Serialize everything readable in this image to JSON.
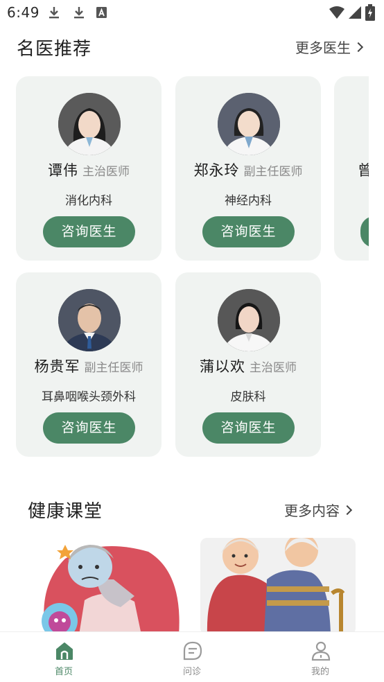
{
  "status_bar": {
    "time": "6:49"
  },
  "doctors_section": {
    "title": "名医推荐",
    "more_label": "更多医生"
  },
  "doctors": [
    {
      "name": "谭伟",
      "title": "主治医师",
      "dept": "消化内科",
      "button": "咨询医生"
    },
    {
      "name": "郑永玲",
      "title": "副主任医师",
      "dept": "神经内科",
      "button": "咨询医生"
    },
    {
      "name": "杨贵军",
      "title": "副主任医师",
      "dept": "耳鼻咽喉头颈外科",
      "button": "咨询医生"
    },
    {
      "name": "蒲以欢",
      "title": "主治医师",
      "dept": "皮肤科",
      "button": "咨询医生"
    }
  ],
  "partial_doctor": {
    "name_fragment": "曾"
  },
  "health_section": {
    "title": "健康课堂",
    "more_label": "更多内容"
  },
  "bottom_nav": [
    {
      "label": "首页",
      "icon": "home-icon",
      "active": true
    },
    {
      "label": "问诊",
      "icon": "chat-icon",
      "active": false
    },
    {
      "label": "我的",
      "icon": "person-icon",
      "active": false
    }
  ],
  "colors": {
    "accent": "#4b8766",
    "card_bg": "#f0f3f1",
    "muted_text": "#8a8a8a"
  }
}
